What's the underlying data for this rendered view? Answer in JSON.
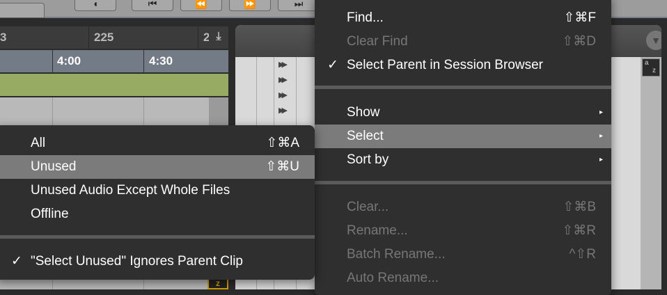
{
  "toolbar": {
    "buttons": [
      "◖",
      "⏮",
      "⏪",
      "⏩",
      "⏭"
    ]
  },
  "ruler": {
    "labels": [
      "3",
      "225",
      "2"
    ]
  },
  "timecode": {
    "labels": [
      "4:00",
      "4:30"
    ]
  },
  "main_menu": {
    "items": [
      {
        "label": "Find...",
        "shortcut": "⇧⌘F",
        "enabled": true
      },
      {
        "label": "Clear Find",
        "shortcut": "⇧⌘D",
        "enabled": false
      },
      {
        "label": "Select Parent in Session Browser",
        "checked": true,
        "enabled": true
      },
      {
        "label": "Show",
        "submenu": true
      },
      {
        "label": "Select",
        "submenu": true,
        "highlighted": true
      },
      {
        "label": "Sort by",
        "submenu": true
      },
      {
        "label": "Clear...",
        "shortcut": "⇧⌘B",
        "enabled": false
      },
      {
        "label": "Rename...",
        "shortcut": "⇧⌘R",
        "enabled": false
      },
      {
        "label": "Batch Rename...",
        "shortcut": "^⇧R",
        "enabled": false
      },
      {
        "label": "Auto Rename...",
        "enabled": false
      }
    ],
    "check": "✓",
    "submenu_arrow": "▸"
  },
  "select_submenu": {
    "items": [
      {
        "label": "All",
        "shortcut": "⇧⌘A"
      },
      {
        "label": "Unused",
        "shortcut": "⇧⌘U",
        "highlighted": true
      },
      {
        "label": "Unused Audio Except Whole Files"
      },
      {
        "label": "Offline"
      },
      {
        "label": "\"Select Unused\" Ignores Parent Clip",
        "checked": true
      }
    ]
  },
  "sort_icon": {
    "a": "a",
    "z": "z"
  },
  "colors": {
    "menu_bg": "#2f2f2f",
    "highlight": "#7b7b7b",
    "clip_green": "#97ab62"
  }
}
